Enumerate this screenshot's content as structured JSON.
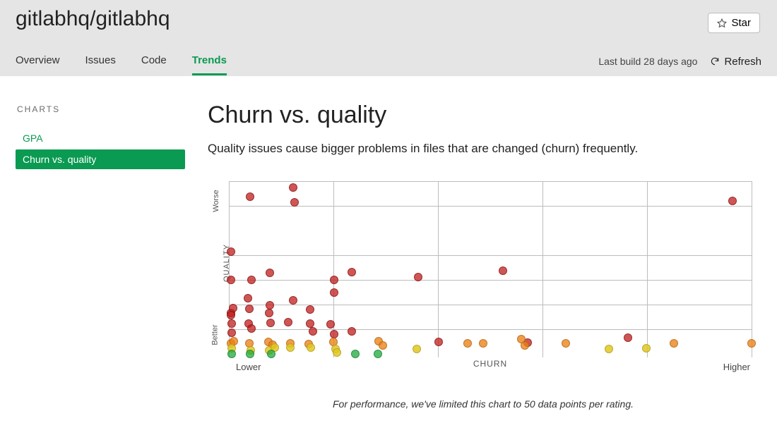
{
  "header": {
    "repo_name": "gitlabhq/gitlabhq",
    "star_label": "Star",
    "tabs": [
      {
        "label": "Overview",
        "active": false
      },
      {
        "label": "Issues",
        "active": false
      },
      {
        "label": "Code",
        "active": false
      },
      {
        "label": "Trends",
        "active": true
      }
    ],
    "build_status": "Last build 28 days ago",
    "refresh_label": "Refresh"
  },
  "sidebar": {
    "heading": "CHARTS",
    "items": [
      {
        "label": "GPA",
        "selected": false
      },
      {
        "label": "Churn vs. quality",
        "selected": true
      }
    ]
  },
  "main": {
    "title": "Churn vs. quality",
    "subtitle": "Quality issues cause bigger problems in files that are changed (churn) frequently."
  },
  "chart_data": {
    "type": "scatter",
    "xlabel": "CHURN",
    "ylabel": "QUALITY",
    "x_axis_hints": {
      "low": "Lower",
      "high": "Higher"
    },
    "y_axis_hints": {
      "low": "Better",
      "high": "Worse"
    },
    "xlim": [
      0,
      100
    ],
    "ylim": [
      0,
      100
    ],
    "grid_hlines": [
      16,
      30,
      44,
      58,
      86,
      100
    ],
    "grid_vlines": [
      0,
      20,
      40,
      60,
      80,
      100
    ],
    "series": [
      {
        "name": "red",
        "color": "#c01e1e",
        "points": [
          {
            "x": 12.3,
            "y": 96.4
          },
          {
            "x": 4.1,
            "y": 91.2
          },
          {
            "x": 12.5,
            "y": 88
          },
          {
            "x": 0.4,
            "y": 60
          },
          {
            "x": 0.4,
            "y": 44
          },
          {
            "x": 4.3,
            "y": 44
          },
          {
            "x": 7.9,
            "y": 48
          },
          {
            "x": 20.2,
            "y": 36.8
          },
          {
            "x": 20.1,
            "y": 44
          },
          {
            "x": 23.5,
            "y": 48.4
          },
          {
            "x": 36.2,
            "y": 45.6
          },
          {
            "x": 52.4,
            "y": 49.2
          },
          {
            "x": 0.4,
            "y": 25.2
          },
          {
            "x": 0.8,
            "y": 28
          },
          {
            "x": 0.4,
            "y": 24
          },
          {
            "x": 3.7,
            "y": 33.6
          },
          {
            "x": 3.9,
            "y": 27.6
          },
          {
            "x": 7.9,
            "y": 29.6
          },
          {
            "x": 7.7,
            "y": 25.2
          },
          {
            "x": 12.3,
            "y": 32.4
          },
          {
            "x": 15.5,
            "y": 27.2
          },
          {
            "x": 0.6,
            "y": 14
          },
          {
            "x": 0.6,
            "y": 19.2
          },
          {
            "x": 3.8,
            "y": 19.2
          },
          {
            "x": 4.3,
            "y": 16.4
          },
          {
            "x": 8.0,
            "y": 19.6
          },
          {
            "x": 11.4,
            "y": 20
          },
          {
            "x": 15.6,
            "y": 19.2
          },
          {
            "x": 16.1,
            "y": 14.8
          },
          {
            "x": 19.4,
            "y": 18.8
          },
          {
            "x": 20.1,
            "y": 13.2
          },
          {
            "x": 23.5,
            "y": 14.8
          },
          {
            "x": 40.2,
            "y": 8.8
          },
          {
            "x": 57.2,
            "y": 8.4
          },
          {
            "x": 76.3,
            "y": 11.2
          },
          {
            "x": 96.4,
            "y": 88.8
          }
        ]
      },
      {
        "name": "orange",
        "color": "#eb8214",
        "points": [
          {
            "x": 0.4,
            "y": 8.0
          },
          {
            "x": 0.9,
            "y": 9.2
          },
          {
            "x": 3.9,
            "y": 8.0
          },
          {
            "x": 7.6,
            "y": 8.8
          },
          {
            "x": 8.4,
            "y": 7.2
          },
          {
            "x": 11.8,
            "y": 8.0
          },
          {
            "x": 15.3,
            "y": 7.6
          },
          {
            "x": 20.0,
            "y": 8.8
          },
          {
            "x": 28.6,
            "y": 9.2
          },
          {
            "x": 29.4,
            "y": 6.8
          },
          {
            "x": 45.7,
            "y": 8.0
          },
          {
            "x": 48.6,
            "y": 8.0
          },
          {
            "x": 55.9,
            "y": 10.4
          },
          {
            "x": 56.6,
            "y": 6.8
          },
          {
            "x": 64.4,
            "y": 8.0
          },
          {
            "x": 85.2,
            "y": 8.0
          },
          {
            "x": 100.0,
            "y": 8.0
          }
        ]
      },
      {
        "name": "yellow",
        "color": "#e1c823",
        "points": [
          {
            "x": 0.5,
            "y": 5.2
          },
          {
            "x": 4.2,
            "y": 4.0
          },
          {
            "x": 7.7,
            "y": 4.0
          },
          {
            "x": 8.8,
            "y": 5.6
          },
          {
            "x": 11.7,
            "y": 5.6
          },
          {
            "x": 15.7,
            "y": 5.6
          },
          {
            "x": 20.4,
            "y": 4.8
          },
          {
            "x": 20.7,
            "y": 2.8
          },
          {
            "x": 35.9,
            "y": 4.8
          },
          {
            "x": 72.7,
            "y": 4.8
          },
          {
            "x": 79.8,
            "y": 5.2
          }
        ]
      },
      {
        "name": "green",
        "color": "#1eaa3c",
        "points": [
          {
            "x": 0.5,
            "y": 2.0
          },
          {
            "x": 4.1,
            "y": 2.0
          },
          {
            "x": 8.1,
            "y": 2.0
          },
          {
            "x": 24.2,
            "y": 2.0
          },
          {
            "x": 28.5,
            "y": 2.0
          }
        ]
      }
    ],
    "footnote": "For performance, we've limited this chart to 50 data points per rating."
  }
}
